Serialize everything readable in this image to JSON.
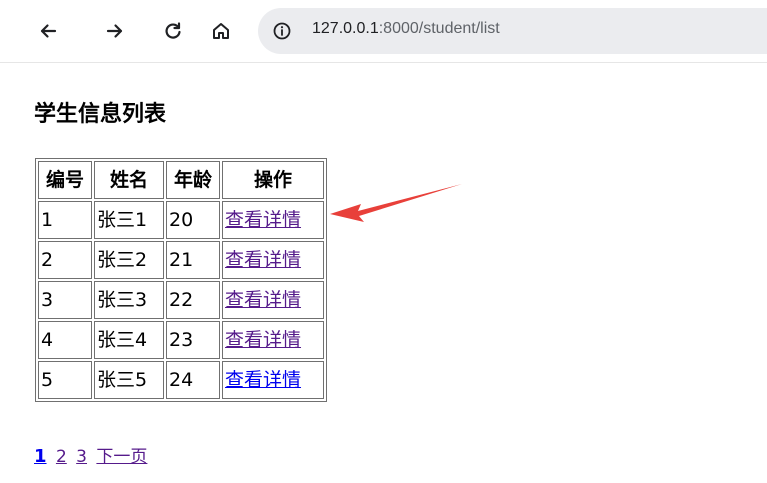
{
  "browser": {
    "back_icon": "arrow-left-icon",
    "forward_icon": "arrow-right-icon",
    "reload_icon": "reload-icon",
    "home_icon": "home-icon",
    "info_icon": "info-icon",
    "url_host": "127.0.0.1",
    "url_rest": ":8000/student/list"
  },
  "page": {
    "title": "学生信息列表"
  },
  "table": {
    "headers": {
      "id": "编号",
      "name": "姓名",
      "age": "年龄",
      "op": "操作"
    },
    "rows": [
      {
        "id": "1",
        "name": "张三1",
        "age": "20",
        "link": "查看详情"
      },
      {
        "id": "2",
        "name": "张三2",
        "age": "21",
        "link": "查看详情"
      },
      {
        "id": "3",
        "name": "张三3",
        "age": "22",
        "link": "查看详情"
      },
      {
        "id": "4",
        "name": "张三4",
        "age": "23",
        "link": "查看详情"
      },
      {
        "id": "5",
        "name": "张三5",
        "age": "24",
        "link": "查看详情"
      }
    ]
  },
  "pagination": {
    "pages": [
      "1",
      "2",
      "3"
    ],
    "current": "1",
    "next_label": "下一页"
  },
  "colors": {
    "annotation_arrow": "#e8403a",
    "visited_link": "#551a8b",
    "unvisited_link": "#0000ee"
  }
}
